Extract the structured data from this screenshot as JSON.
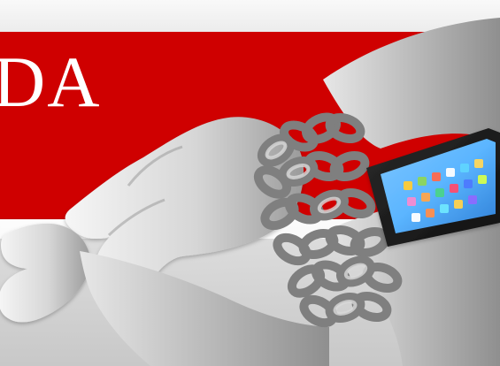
{
  "banner": {
    "visible_text": "DA",
    "background_color": "#cf0000",
    "text_color": "#ffffff"
  },
  "scene": {
    "subject_icons": [
      "hands-icon",
      "chains-icon",
      "smartphone-icon"
    ]
  }
}
